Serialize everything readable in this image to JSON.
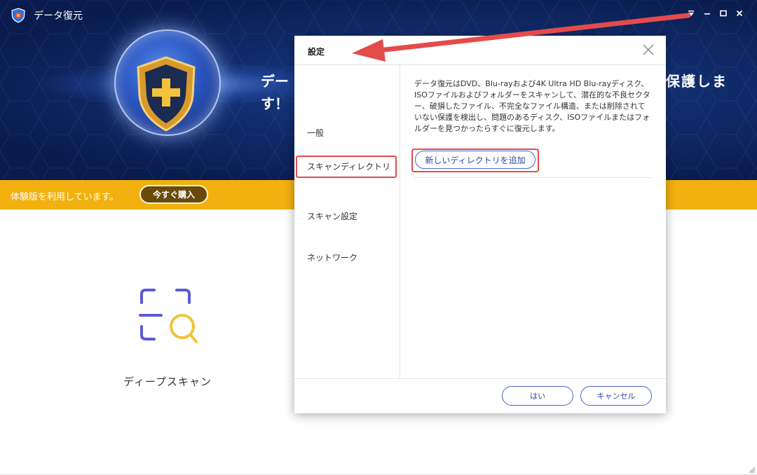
{
  "app": {
    "title": "データ復元"
  },
  "banner": {
    "headline_part1": "デー",
    "headline_part2": "す！",
    "headline_right": "保護しま"
  },
  "trial": {
    "text": "体験版を利用しています。",
    "buy_label": "今すぐ購入"
  },
  "main": {
    "deep_scan_label": "ディープスキャン"
  },
  "dialog": {
    "title": "設定",
    "nav": [
      {
        "label": "一般"
      },
      {
        "label": "スキャンディレクトリ"
      },
      {
        "label": "スキャン設定"
      },
      {
        "label": "ネットワーク"
      }
    ],
    "selected_nav": "スキャンディレクトリ",
    "description": "データ復元はDVD、Blu-rayおよび4K Ultra HD Blu-rayディスク、ISOファイルおよびフォルダーをスキャンして、潜在的な不良セクター、破損したファイル、不完全なファイル構造、または削除されていない保護を検出し、問題のあるディスク、ISOファイルまたはフォルダーを見つかったらすぐに復元します。",
    "add_directory_label": "新しいディレクトリを追加",
    "ok_label": "はい",
    "cancel_label": "キャンセル"
  },
  "colors": {
    "accent_blue": "#2c46a8",
    "trial_bar": "#f3b10f",
    "highlight_red": "#e44b4b",
    "header_dark": "#0a1c4d"
  },
  "icons": [
    "app-shield-logo-icon",
    "dropdown-menu-icon",
    "minimize-icon",
    "maximize-icon",
    "close-icon",
    "deep-scan-icon",
    "dialog-close-icon",
    "resize-grip-icon"
  ]
}
